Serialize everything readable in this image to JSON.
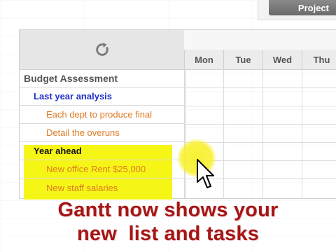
{
  "toolbar": {
    "project_label": "Project"
  },
  "task_list": {
    "rows": [
      {
        "label": "Budget Assessment"
      },
      {
        "label": "Last year analysis"
      },
      {
        "label": "Each dept to produce final"
      },
      {
        "label": "Detail the overuns"
      },
      {
        "label": "Year ahead"
      },
      {
        "label": "New office Rent $25,000"
      },
      {
        "label": "New staff salaries"
      }
    ]
  },
  "calendar": {
    "days": [
      "Mon",
      "Tue",
      "Wed",
      "Thu"
    ]
  },
  "caption": {
    "line1": "Gantt now shows your",
    "line2": "new  list and tasks"
  },
  "colors": {
    "highlight": "#f6f616",
    "list_blue": "#1f2fc8",
    "task_orange": "#e07a24",
    "caption_red": "#a51616"
  },
  "icons": [
    "refresh-icon",
    "mouse-pointer-icon"
  ]
}
